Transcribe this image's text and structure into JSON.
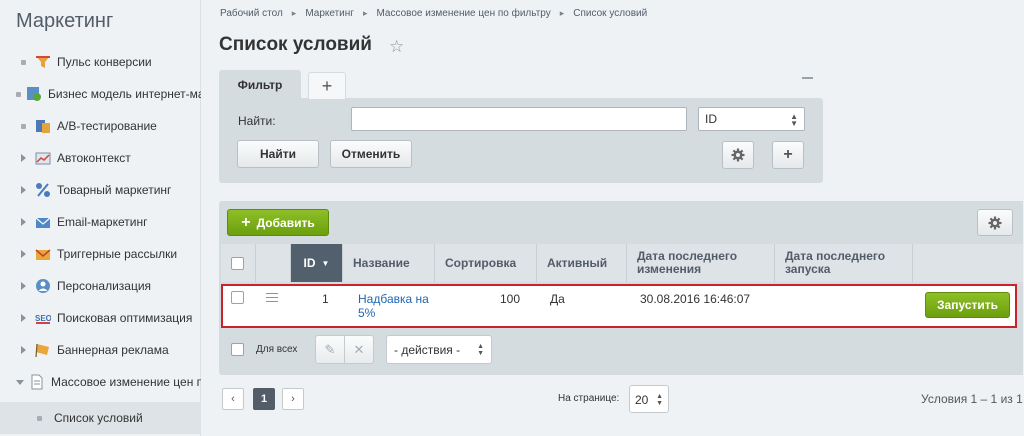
{
  "sidebar": {
    "title": "Маркетинг",
    "items": [
      {
        "label": "Пульс конверсии",
        "icon": "funnel-icon"
      },
      {
        "label": "Бизнес модель интернет-магазина",
        "icon": "business-model-icon"
      },
      {
        "label": "А/В-тестирование",
        "icon": "ab-test-icon"
      },
      {
        "label": "Автоконтекст",
        "icon": "chart-icon"
      },
      {
        "label": "Товарный маркетинг",
        "icon": "percent-icon"
      },
      {
        "label": "Email-маркетинг",
        "icon": "email-icon"
      },
      {
        "label": "Триггерные рассылки",
        "icon": "trigger-mail-icon"
      },
      {
        "label": "Персонализация",
        "icon": "person-icon"
      },
      {
        "label": "Поисковая оптимизация",
        "icon": "seo-icon"
      },
      {
        "label": "Баннерная реклама",
        "icon": "banner-icon"
      },
      {
        "label": "Массовое изменение цен по фильтру",
        "icon": "document-icon"
      },
      {
        "label": "Список условий"
      }
    ]
  },
  "breadcrumb": [
    "Рабочий стол",
    "Маркетинг",
    "Массовое изменение цен по фильтру",
    "Список условий"
  ],
  "page": {
    "title": "Список условий"
  },
  "filter": {
    "tab_label": "Фильтр",
    "find_label": "Найти:",
    "find_value": "",
    "field_select": "ID",
    "find_button": "Найти",
    "cancel_button": "Отменить"
  },
  "grid": {
    "add_button": "Добавить",
    "columns": [
      "ID",
      "Название",
      "Сортировка",
      "Активный",
      "Дата последнего изменения",
      "Дата последнего запуска"
    ],
    "rows": [
      {
        "id": "1",
        "name": "Надбавка на 5%",
        "sort": "100",
        "active": "Да",
        "modified": "30.08.2016 16:46:07",
        "launched": "",
        "run_button": "Запустить"
      }
    ],
    "for_all_label": "Для всех",
    "actions_select": "- действия -"
  },
  "pagination": {
    "current_page": "1",
    "per_page_label": "На странице:",
    "per_page_value": "20",
    "total_text": "Условия 1 – 1 из 1"
  },
  "colors": {
    "accent_green": "#7cb21d",
    "highlight_border": "#c6232a",
    "link": "#2067b0",
    "sorted_header": "#52606e"
  }
}
